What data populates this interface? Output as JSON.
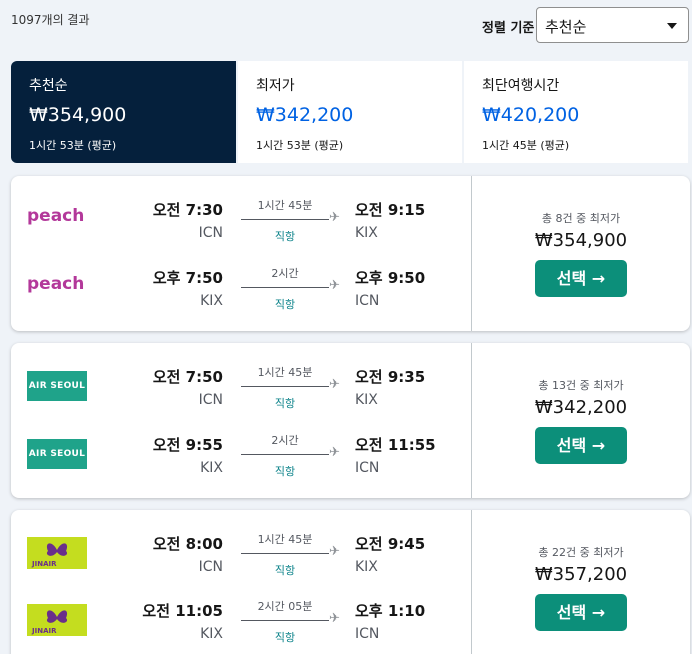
{
  "header": {
    "results_count": "1097개의 결과",
    "sort_label": "정렬 기준",
    "sort_value": "추천순"
  },
  "tabs": [
    {
      "label": "추천순",
      "price": "₩354,900",
      "time": "1시간 53분 (평균)",
      "active": true
    },
    {
      "label": "최저가",
      "price": "₩342,200",
      "time": "1시간 53분 (평균)",
      "active": false
    },
    {
      "label": "최단여행시간",
      "price": "₩420,200",
      "time": "1시간 45분 (평균)",
      "active": false
    }
  ],
  "colors": {
    "accent_dark": "#05203c",
    "price_blue": "#0062e3",
    "select_button": "#0c8f7a",
    "direct_teal": "#0c838a"
  },
  "results": [
    {
      "airline": "peach",
      "legs": [
        {
          "logo_text": "peach",
          "dep_time": "오전 7:30",
          "dep_code": "ICN",
          "duration": "1시간 45분",
          "stops": "직항",
          "arr_time": "오전 9:15",
          "arr_code": "KIX"
        },
        {
          "logo_text": "peach",
          "dep_time": "오후 7:50",
          "dep_code": "KIX",
          "duration": "2시간",
          "stops": "직항",
          "arr_time": "오후 9:50",
          "arr_code": "ICN"
        }
      ],
      "deals_info": "총 8건 중 최저가",
      "price": "₩354,900",
      "select_label": "선택 →"
    },
    {
      "airline": "airseoul",
      "legs": [
        {
          "logo_text": "AIR SEOUL",
          "dep_time": "오전 7:50",
          "dep_code": "ICN",
          "duration": "1시간 45분",
          "stops": "직항",
          "arr_time": "오전 9:35",
          "arr_code": "KIX"
        },
        {
          "logo_text": "AIR SEOUL",
          "dep_time": "오전 9:55",
          "dep_code": "KIX",
          "duration": "2시간",
          "stops": "직항",
          "arr_time": "오전 11:55",
          "arr_code": "ICN"
        }
      ],
      "deals_info": "총 13건 중 최저가",
      "price": "₩342,200",
      "select_label": "선택 →"
    },
    {
      "airline": "jinair",
      "legs": [
        {
          "logo_text": "JINAIR",
          "dep_time": "오전 8:00",
          "dep_code": "ICN",
          "duration": "1시간 45분",
          "stops": "직항",
          "arr_time": "오전 9:45",
          "arr_code": "KIX"
        },
        {
          "logo_text": "JINAIR",
          "dep_time": "오전 11:05",
          "dep_code": "KIX",
          "duration": "2시간 05분",
          "stops": "직항",
          "arr_time": "오후 1:10",
          "arr_code": "ICN"
        }
      ],
      "deals_info": "총 22건 중 최저가",
      "price": "₩357,200",
      "select_label": "선택 →"
    }
  ]
}
